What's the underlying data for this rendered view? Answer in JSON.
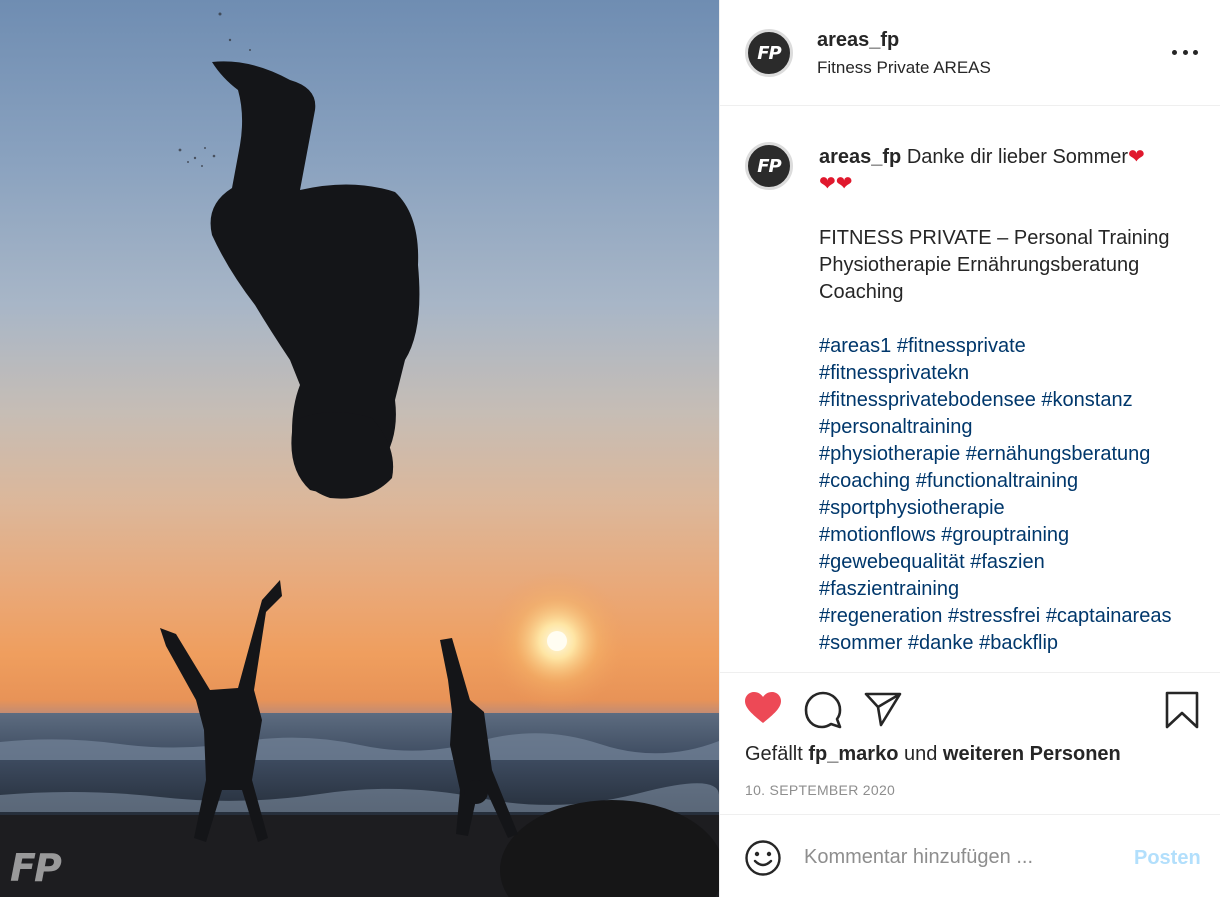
{
  "post": {
    "username": "areas_fp",
    "display_name": "Fitness Private AREAS",
    "avatar_text": "FP",
    "photo_watermark": "FP"
  },
  "caption": {
    "username": "areas_fp",
    "line1": "Danke dir lieber Sommer",
    "hearts": "❤",
    "body_lines": [
      "FITNESS PRIVATE – Personal Training",
      "Physiotherapie Ernährungsberatung",
      "Coaching"
    ],
    "hashtag_lines": [
      [
        "#areas1",
        "#fitnessprivate"
      ],
      [
        "#fitnessprivatekn"
      ],
      [
        "#fitnessprivatebodensee",
        "#konstanz"
      ],
      [
        "#personaltraining"
      ],
      [
        "#physiotherapie",
        "#ernähungsberatung"
      ],
      [
        "#coaching",
        "#functionaltraining"
      ],
      [
        "#sportphysiotherapie"
      ],
      [
        "#motionflows",
        "#grouptraining"
      ],
      [
        "#gewebequalität",
        "#faszien"
      ],
      [
        "#faszientraining"
      ],
      [
        "#regeneration",
        "#stressfrei",
        "#captainareas"
      ],
      [
        "#sommer",
        "#danke",
        "#backflip"
      ]
    ]
  },
  "likes": {
    "prefix": "Gefällt",
    "user": "fp_marko",
    "middle": "und",
    "suffix": "weiteren Personen"
  },
  "date": "10. SEPTEMBER 2020",
  "comment": {
    "placeholder": "Kommentar hinzufügen ...",
    "post_label": "Posten"
  },
  "colors": {
    "like_red": "#ed4956",
    "hashtag_blue": "#00376b",
    "post_button_disabled": "#b2dffc"
  },
  "icons": {
    "like": "heart-filled-icon",
    "comment": "speech-bubble-icon",
    "share": "paper-plane-icon",
    "save": "bookmark-icon",
    "emoji": "smiley-icon",
    "more": "three-dots-icon"
  }
}
